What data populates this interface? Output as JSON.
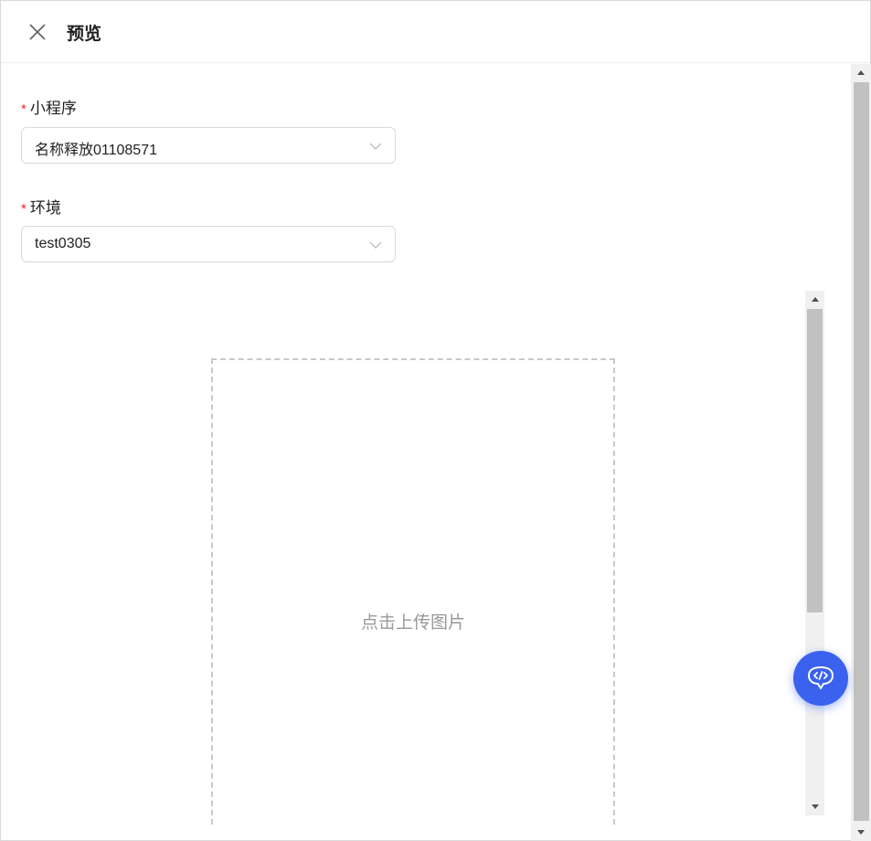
{
  "header": {
    "title": "预览",
    "close_icon": "close-icon"
  },
  "form": {
    "miniprogram": {
      "label": "小程序",
      "required_mark": "*",
      "value": "名称释放01108571"
    },
    "environment": {
      "label": "环境",
      "required_mark": "*",
      "value": "test0305"
    }
  },
  "upload": {
    "text": "点击上传图片"
  },
  "fab": {
    "icon": "code-chat-icon",
    "color": "#3a62ee"
  },
  "colors": {
    "required": "#f5222d",
    "placeholder_text": "#999999"
  }
}
